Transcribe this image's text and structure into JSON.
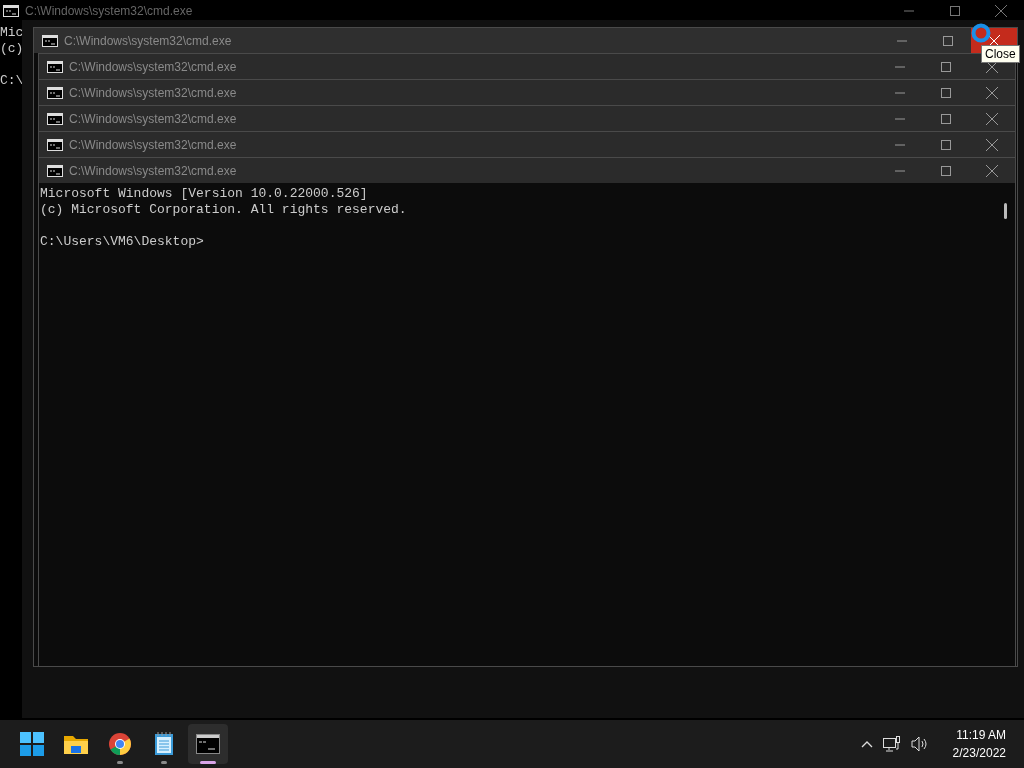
{
  "background_window": {
    "title": "C:\\Windows\\system32\\cmd.exe",
    "lines": [
      "Mic",
      "(c)",
      "C:\\"
    ]
  },
  "windows": [
    {
      "title": "C:\\Windows\\system32\\cmd.exe",
      "close_hovered": true,
      "tooltip": "Close"
    },
    {
      "title": "C:\\Windows\\system32\\cmd.exe",
      "close_hovered": false
    },
    {
      "title": "C:\\Windows\\system32\\cmd.exe",
      "close_hovered": false
    },
    {
      "title": "C:\\Windows\\system32\\cmd.exe",
      "close_hovered": false
    },
    {
      "title": "C:\\Windows\\system32\\cmd.exe",
      "close_hovered": false
    },
    {
      "title": "C:\\Windows\\system32\\cmd.exe",
      "close_hovered": false
    }
  ],
  "console": {
    "lines": [
      "Microsoft Windows [Version 10.0.22000.526]",
      "(c) Microsoft Corporation. All rights reserved."
    ],
    "prompt": "C:\\Users\\VM6\\Desktop>"
  },
  "taskbar": {
    "items": [
      {
        "kind": "start",
        "running": false,
        "selected": false
      },
      {
        "kind": "folder",
        "running": false,
        "selected": false
      },
      {
        "kind": "browser",
        "running": true,
        "selected": false
      },
      {
        "kind": "notepad",
        "running": true,
        "selected": false
      },
      {
        "kind": "terminal",
        "running": true,
        "selected": true
      }
    ],
    "time": "11:19 AM",
    "date": "2/23/2022"
  }
}
